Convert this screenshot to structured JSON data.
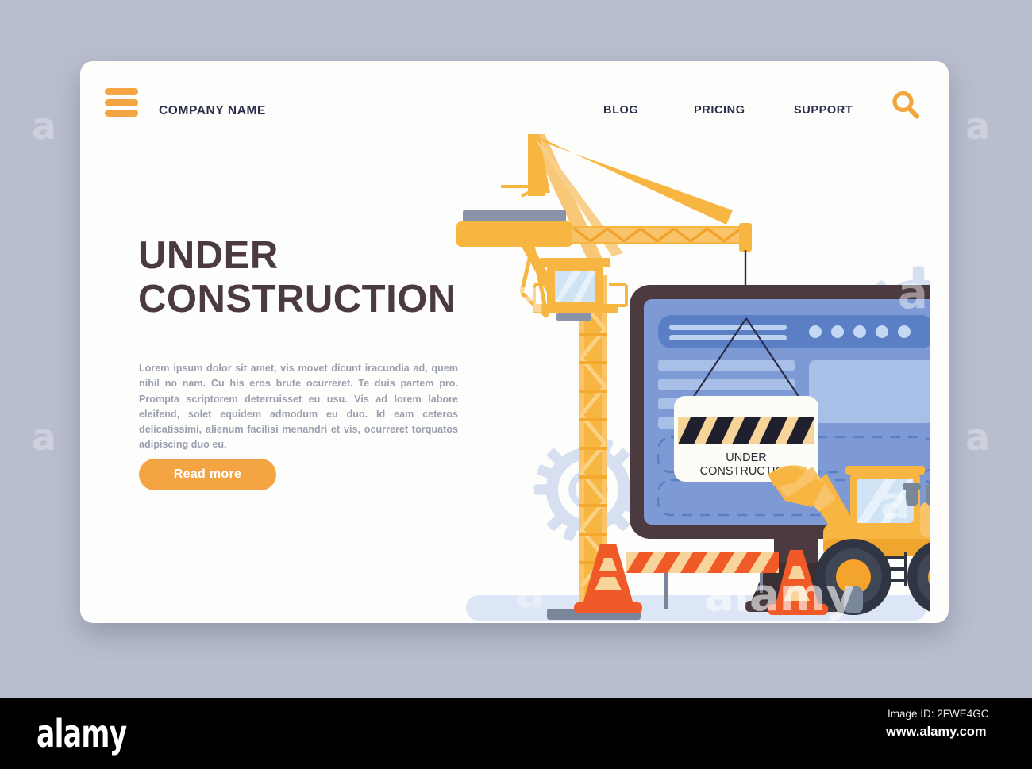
{
  "background": {
    "color": "#b9bece",
    "watermark_glyph": "a"
  },
  "card": {
    "background": "#fdfdfb"
  },
  "header": {
    "menu_icon": "hamburger-icon",
    "brand": "COMPANY NAME",
    "nav": [
      {
        "label": "BLOG"
      },
      {
        "label": "PRICING"
      },
      {
        "label": "SUPPORT"
      }
    ],
    "search_icon": "search-icon",
    "accent_color": "#f4a443",
    "text_color": "#2a2e4a"
  },
  "hero": {
    "title_line1": "UNDER",
    "title_line2": "CONSTRUCTION",
    "title_color": "#4b3a3f",
    "body": "Lorem ipsum dolor sit amet, vis movet dicunt iracundia ad, quem nihil no nam. Cu his eros brute ocurreret. Te duis partem pro. Prompta scriptorem deterruisset eu usu. Vis ad lorem labore eleifend, solet equidem admodum eu duo. Id eam ceteros delicatissimi, alienum facilisi menandri et vis, ocurreret torquatos adipiscing duo eu.",
    "body_color": "#9aa0b0",
    "cta_label": "Read more",
    "cta_color": "#f4a443"
  },
  "illustration": {
    "name": "under-construction-scene",
    "sign": {
      "line1": "UNDER",
      "line2": "CONSTRUCTION",
      "text_color": "#2b2b33",
      "stripe_colors": [
        "#f7d49a",
        "#1f1f2e"
      ],
      "panel_color": "#fdfdf7"
    },
    "monitor": {
      "bezel_color": "#4b3a3f",
      "screen_color": "#7d9ad4",
      "browser_bar_color": "#5b7fc4",
      "placeholder_line_color": "#a8bfe8",
      "dots": 5
    },
    "crane": {
      "color": "#f7b542",
      "cab_glass_color": "#cfe3f5",
      "cable_color": "#2a2e4a"
    },
    "loader": {
      "body_color": "#f7b542",
      "wheel_color": "#3f4654",
      "hub_color": "#f7a22b",
      "cab_glass_color": "#cfe3f5"
    },
    "cone": {
      "colors": [
        "#f05a28",
        "#f7d49a"
      ]
    },
    "barrier": {
      "colors": [
        "#f05a28",
        "#f7d49a"
      ],
      "post_color": "#7a8699"
    },
    "gear_color": "#d6e0f0",
    "ground_color": "#dce6f6"
  },
  "footer": {
    "logo": "alamy",
    "image_id": "Image ID: 2FWE4GC",
    "url": "www.alamy.com",
    "background": "#000000"
  }
}
